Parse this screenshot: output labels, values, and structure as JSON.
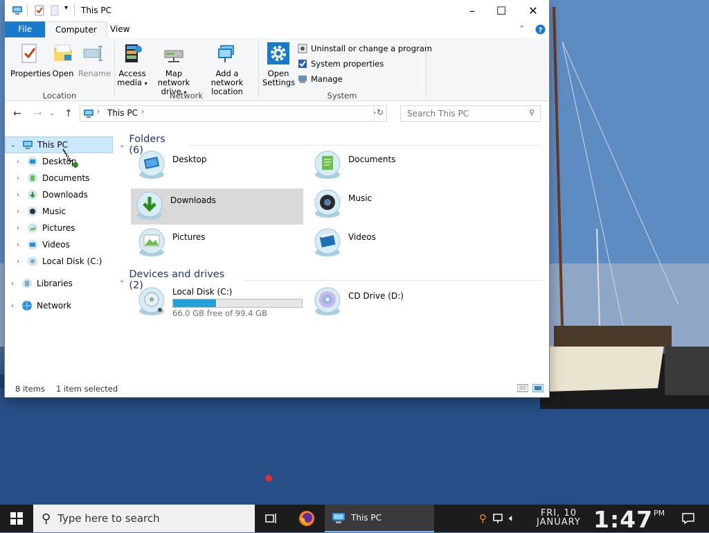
{
  "window": {
    "title": "This PC",
    "controls": {
      "minimize": "–",
      "maximize": "☐",
      "close": "✕"
    }
  },
  "ribbon": {
    "tabs": [
      "File",
      "Computer",
      "View"
    ],
    "location": {
      "properties": "Properties",
      "open": "Open",
      "rename": "Rename",
      "label": "Location"
    },
    "network": {
      "access_media_1": "Access",
      "access_media_2": "media",
      "map_drive_1": "Map network",
      "map_drive_2": "drive",
      "add_location_1": "Add a network",
      "add_location_2": "location",
      "label": "Network"
    },
    "system": {
      "open_settings_1": "Open",
      "open_settings_2": "Settings",
      "uninstall": "Uninstall or change a program",
      "system_properties": "System properties",
      "manage": "Manage",
      "label": "System"
    }
  },
  "address": {
    "path": "This PC",
    "search_placeholder": "Search This PC"
  },
  "navpane": {
    "items": [
      "This PC",
      "Desktop",
      "Documents",
      "Downloads",
      "Music",
      "Pictures",
      "Videos",
      "Local Disk (C:)",
      "Libraries",
      "Network"
    ]
  },
  "content": {
    "folders_header": "Folders (6)",
    "folders": [
      "Desktop",
      "Documents",
      "Downloads",
      "Music",
      "Pictures",
      "Videos"
    ],
    "devices_header": "Devices and drives (2)",
    "drives": [
      {
        "name": "Local Disk (C:)",
        "free_text": "66.0 GB free of 99.4 GB",
        "used_fraction": 0.336
      },
      {
        "name": "CD Drive (D:)"
      }
    ]
  },
  "status": {
    "items": "8 items",
    "selected": "1 item selected"
  },
  "taskbar": {
    "search_placeholder": "Type here to search",
    "active_app": "This PC",
    "date_line1": "FRI, 10",
    "date_line2": "JANUARY",
    "time": "1:47",
    "ampm": "PM"
  },
  "colors": {
    "accent": "#1979ca",
    "selection": "#cce8ff",
    "drive_bar": "#26a0da",
    "taskbar": "#1c1c1c"
  }
}
